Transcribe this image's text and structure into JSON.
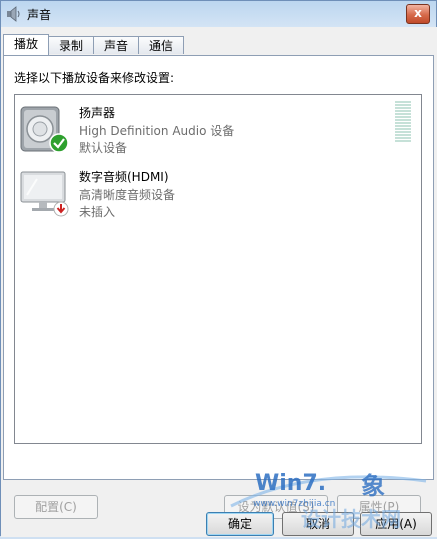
{
  "window": {
    "title": "声音",
    "close_label": "x"
  },
  "tabs": [
    {
      "label": "播放",
      "active": true
    },
    {
      "label": "录制",
      "active": false
    },
    {
      "label": "声音",
      "active": false
    },
    {
      "label": "通信",
      "active": false
    }
  ],
  "playback": {
    "instruction": "选择以下播放设备来修改设置:",
    "devices": [
      {
        "name": "扬声器",
        "description": "High Definition Audio 设备",
        "status": "默认设备",
        "icon": "speaker-icon",
        "badge": "default-check-icon"
      },
      {
        "name": "数字音频(HDMI)",
        "description": "高清晰度音频设备",
        "status": "未插入",
        "icon": "monitor-icon",
        "badge": "unplugged-icon"
      }
    ],
    "buttons": {
      "configure": "配置(C)",
      "set_default": "设为默认值(S)",
      "properties": "属性(P)"
    }
  },
  "dialog_buttons": {
    "ok": "确定",
    "cancel": "取消",
    "apply": "应用(A)"
  },
  "watermark": {
    "brand": "Win7.",
    "brand_suffix": "象",
    "site": "www.win7zhijia.cn",
    "tagline": "设计技术网"
  },
  "colors": {
    "accent": "#3c7fb1",
    "check_green": "#2ea02e",
    "unplugged_red": "#cc2222"
  }
}
